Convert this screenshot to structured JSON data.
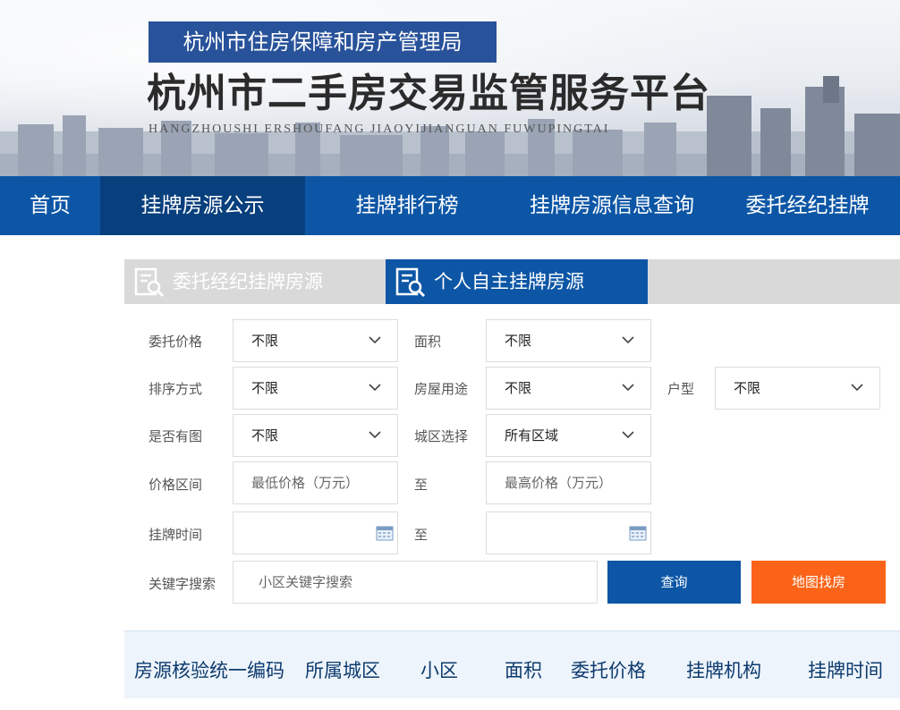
{
  "header": {
    "agency": "杭州市住房保障和房产管理局",
    "platform_title": "杭州市二手房交易监管服务平台",
    "platform_pinyin": "HANGZHOUSHI  ERSHOUFANG  JIAOYIJIANGUAN  FUWUPINGTAI"
  },
  "nav": {
    "items": [
      {
        "label": "首页"
      },
      {
        "label": "挂牌房源公示",
        "active": true
      },
      {
        "label": "挂牌排行榜"
      },
      {
        "label": "挂牌房源信息查询"
      },
      {
        "label": "委托经纪挂牌"
      }
    ]
  },
  "tabs": [
    {
      "label": "委托经纪挂牌房源",
      "active": false
    },
    {
      "label": "个人自主挂牌房源",
      "active": true
    }
  ],
  "form": {
    "price": {
      "label": "委托价格",
      "value": "不限"
    },
    "area": {
      "label": "面积",
      "value": "不限"
    },
    "sort": {
      "label": "排序方式",
      "value": "不限"
    },
    "usage": {
      "label": "房屋用途",
      "value": "不限"
    },
    "layout": {
      "label": "户型",
      "value": "不限"
    },
    "has_photo": {
      "label": "是否有图",
      "value": "不限"
    },
    "district": {
      "label": "城区选择",
      "value": "所有区域"
    },
    "price_range": {
      "label": "价格区间",
      "min_placeholder": "最低价格（万元）",
      "to": "至",
      "max_placeholder": "最高价格（万元）"
    },
    "list_time": {
      "label": "挂牌时间",
      "to": "至"
    },
    "keyword": {
      "label": "关键字搜索",
      "placeholder": "小区关键字搜索"
    },
    "query_button": "查询",
    "map_button": "地图找房"
  },
  "table": {
    "columns": [
      "房源核验统一编码",
      "所属城区",
      "小区",
      "面积",
      "委托价格",
      "挂牌机构",
      "挂牌时间"
    ]
  },
  "colors": {
    "primary": "#0d56a6",
    "nav_active": "#083f7d",
    "agency_box": "#28529a",
    "accent_orange": "#fb6418",
    "tab_inactive": "#d9d9d9",
    "table_header_bg": "#eef4fb"
  }
}
